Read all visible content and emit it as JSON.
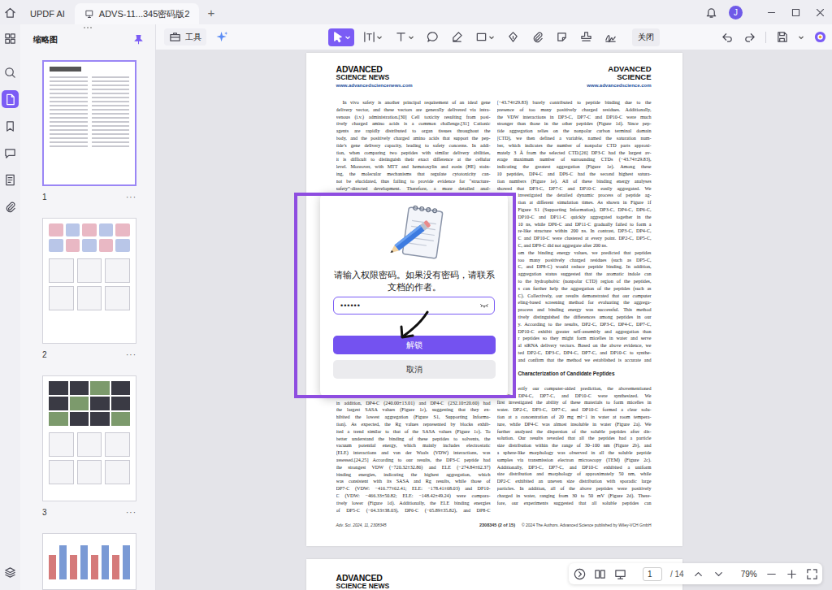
{
  "tabs": [
    {
      "label": "UPDF AI",
      "selected": false
    },
    {
      "label": "ADVS-11...345密码版2",
      "selected": true
    }
  ],
  "new_tab": "+",
  "avatar": "J",
  "rail": [
    {
      "selected": false
    },
    {
      "selected": false
    },
    {
      "selected": true
    },
    {
      "selected": false
    },
    {
      "selected": false
    },
    {
      "selected": false
    },
    {
      "selected": false
    }
  ],
  "sidebar": {
    "title": "缩略图",
    "pinned": true,
    "thumbnails": [
      {
        "label": "1",
        "more": "···",
        "selected": true,
        "kind": "text"
      },
      {
        "label": "2",
        "more": "···",
        "selected": false,
        "kind": "figure"
      },
      {
        "label": "3",
        "more": "···",
        "selected": false,
        "kind": "photos"
      }
    ],
    "cut_thumbnail": {
      "kind": "chart",
      "selected": false
    }
  },
  "toolbar": {
    "tools_label": "工具",
    "close_label": "关闭",
    "tools": [
      {
        "selected": true
      },
      {
        "selected": false
      },
      {
        "selected": false
      },
      {
        "selected": false
      },
      {
        "selected": false
      },
      {
        "selected": false
      },
      {
        "selected": false
      },
      {
        "selected": false
      },
      {
        "selected": false
      },
      {
        "selected": false
      },
      {
        "selected": false
      }
    ]
  },
  "document": {
    "header": {
      "left_logo": [
        "ADVANCED",
        "SCIENCE NEWS"
      ],
      "left_url": "www.advancedsciencenews.com",
      "right_logo": [
        "ADVANCED",
        "SCIENCE"
      ],
      "right_url": "www.advancedscience.com"
    },
    "left_column": {
      "lines_above": [
        "In vivo safety is another principal requirement of an ideal gene",
        "delivery vector, and these vectors are generally delivered via intra-",
        "venous (i.v.) administration.[30] Cell toxicity resulting from posi-",
        "tively charged amino acids is a common challenge.[31] Cationic",
        "agents are rapidly distributed to organ tissues throughout the",
        "body, and the positively charged amino acids that support the pep-",
        "tide’s gene delivery capacity, leading to safety concerns. In addi-",
        "tion, when comparing two peptides with similar delivery abilities,",
        "it is difficult to distinguish their exact difference at the cellular",
        "level. Moreover, with MTT and hematoxylin and eosin (HE) stain-",
        "ing, the molecular mechanisms that regulate cytotoxicity can-",
        "not be elucidated, thus failing to provide evidence for “structure-",
        "safety”-directed development. Therefore, a more detailed anal-"
      ],
      "lines_below": [
        "in addition, DP4-C (240.00±13.01) and DP4-C (232.10±20.60) had",
        "the largest SASA values (Figure 1c), suggesting that they ex-",
        "hibited the lowest aggregation (Figure S1, Supporting Informa-",
        "tion). As expected, the Rg values represented by blocks exhib-",
        "ited a trend similar to that of the SASA values (Figure 1c). To",
        "better understand the binding of these peptides to solvents, the",
        "vacuum potential energy, which mainly includes electrostatic",
        "(ELE) interactions and van der Waals (VDW) interactions, was",
        "assessed.[24,25] According to our results, the DP3-C peptide had",
        "the strongest VDW (−720.32±32.86) and ELE (−274.84±62.37)",
        "binding energies, indicating the highest aggregation, which",
        "was consistent with its SASA and Rg results, while those of",
        "DP7-C (VDW: −416.77±62.41; ELE: −178.41±68.03) and DP10-",
        "C (VDW: −466.33±50.82; ELE: −148.42±49.24) were compara-",
        "tively lower (Figure 1d). Additionally, the ELE binding energies",
        "of DP5-C (−64.33±38.03), DP6-C (−65.89±35.82), and DP8-C"
      ]
    },
    "right_column": {
      "lines_above": [
        "(−43.74±29.83) barely contributed to peptide binding due to the",
        "presence of too many positively charged residues. Additionally,",
        "the VDW interactions in DP3-C, DP7-C and DP10-C were much",
        "stronger than those in the other peptides (Figure 1d). Since pep-",
        "tide aggregation relies on the nonpolar carbon terminal domain",
        "(CTD), we then defined a variable, named the saturation num-",
        "ber, which indicates the number of nonpolar CTD parts approxi-",
        "mately 3 Å from the selected CTD.[26] DP3-C had the largest av-",
        "erage maximum number of surrounding CTDs (−43.74±29.83),",
        "indicating the greatest aggregation (Figure 1e). Among these",
        "10 peptides, DP4-C and DP6-C had the second highest satura-",
        "tion numbers (Figure 1e). All of these binding energy analyses",
        "showed that DP3-C, DP7-C and DP10-C easily aggregated. We"
      ],
      "lines_beside_dialog": [
        {
          "kind": "line",
          "text": "investigated the detailed dynamic process of peptide ag-"
        },
        {
          "kind": "line",
          "text": "tion at different simulation times. As shown in Figure 1f"
        },
        {
          "kind": "line",
          "text": "Figure S1 (Supporting Information), DP3-C, DP4-C, DP6-C,"
        },
        {
          "kind": "line",
          "text": "DP10-C and DP11-C quickly aggregated together in the"
        },
        {
          "kind": "line",
          "text": "10 ns, while DP6-C and DP11-C gradually failed to form a"
        },
        {
          "kind": "line",
          "text": "re-like structure within 200 ns. In contrast, DP3-C, DP4-C,"
        },
        {
          "kind": "line",
          "text": "C and DP10-C were clustered at every point. DP2-C, DP5-C,"
        },
        {
          "kind": "end",
          "text": "C, and DP9-C did not aggregate after 200 ns."
        },
        {
          "kind": "line",
          "text": "om the binding energy values, we predicted that peptides"
        },
        {
          "kind": "line",
          "text": "too many positively charged residues (such as DP5-C,"
        },
        {
          "kind": "line",
          "text": "C, and DP8-C) would reduce peptide binding. In addition,"
        },
        {
          "kind": "line",
          "text": "aggregation status suggested that the aromatic indole can"
        },
        {
          "kind": "line",
          "text": "to the hydrophobic (nonpolar CTD) region of the peptides,"
        },
        {
          "kind": "line",
          "text": "s can further help the aggregation of the peptides (such as"
        },
        {
          "kind": "line",
          "text": "C). Collectively, our results demonstrated that our computer"
        },
        {
          "kind": "line",
          "text": "eling-based screening method for evaluating the aggrega-"
        },
        {
          "kind": "line",
          "text": "process and binding energy was successful. This method"
        },
        {
          "kind": "line",
          "text": "tively distinguished the differences among peptides in our"
        },
        {
          "kind": "line",
          "text": "y. According to the results, DP2-C, DP3-C, DP4-C, DP7-C,"
        },
        {
          "kind": "line",
          "text": "DP10-C exhibit greater self-assembly and aggregation than"
        },
        {
          "kind": "line",
          "text": "r peptides so they might form micelles in water and serve"
        },
        {
          "kind": "line",
          "text": "al siRNA delivery vectors. Based on the above evidence, we"
        },
        {
          "kind": "line",
          "text": "ted DP2-C, DP3-C, DP4-C, DP7-C, and DP10-C to synthe-"
        },
        {
          "kind": "line",
          "text": "and confirm that the method we established is accurate and"
        },
        {
          "kind": "blank"
        },
        {
          "kind": "heading",
          "text": "Characterization of Candidate Peptides"
        },
        {
          "kind": "blank"
        },
        {
          "kind": "line",
          "text": "erify our computer-aided prediction, the abovementioned"
        }
      ],
      "lines_below": [
        "DP3-C, DP4-C, DP7-C, and DP10-C were synthesized. We",
        "first investigated the ability of these materials to form micelles in",
        "water. DP2-C, DP3-C, DP7-C, and DP10-C formed a clear solu-",
        "tion at a concentration of 20 mg ml−1 in water at room tempera-",
        "ture, while DP4-C was almost insoluble in water (Figure 2a). We",
        "further analyzed the dispersion of the soluble peptides after dis-",
        "solution. Our results revealed that all the peptides had a particle",
        "size distribution within the range of 30–100 nm (Figure 2b), and",
        "a sphere-like morphology was observed in all the soluble peptide",
        "samples via transmission electron microscopy (TEM) (Figure 2c).",
        "Additionally, DP3-C, DP7-C, and DP10-C exhibited a uniform",
        "size distribution and morphology of approximately 50 nm, while",
        "DP2-C exhibited an uneven size distribution with sporadic large",
        "particles. In addition, all of the above peptides were positively",
        "charged in water, ranging from 30 to 50 mV (Figure 2d). There-",
        "fore, our experiments suggested that all soluble peptides can"
      ]
    },
    "footer": {
      "journal": "Adv. Sci. 2024, 11, 2308345",
      "page": "2308345 (2 of 15)",
      "copyright": "© 2024 The Authors. Advanced Science published by Wiley-VCH GmbH"
    },
    "next_page_logo": [
      "ADVANCED",
      "SCIENCE NEWS"
    ]
  },
  "dialog": {
    "message": "请输入权限密码。如果没有密码，请联系文档的作者。",
    "password": "••••••",
    "password_visible": false,
    "unlock": "解锁",
    "cancel": "取消"
  },
  "page_nav": {
    "page": "1",
    "total": "/ 14",
    "zoom": "79%"
  }
}
